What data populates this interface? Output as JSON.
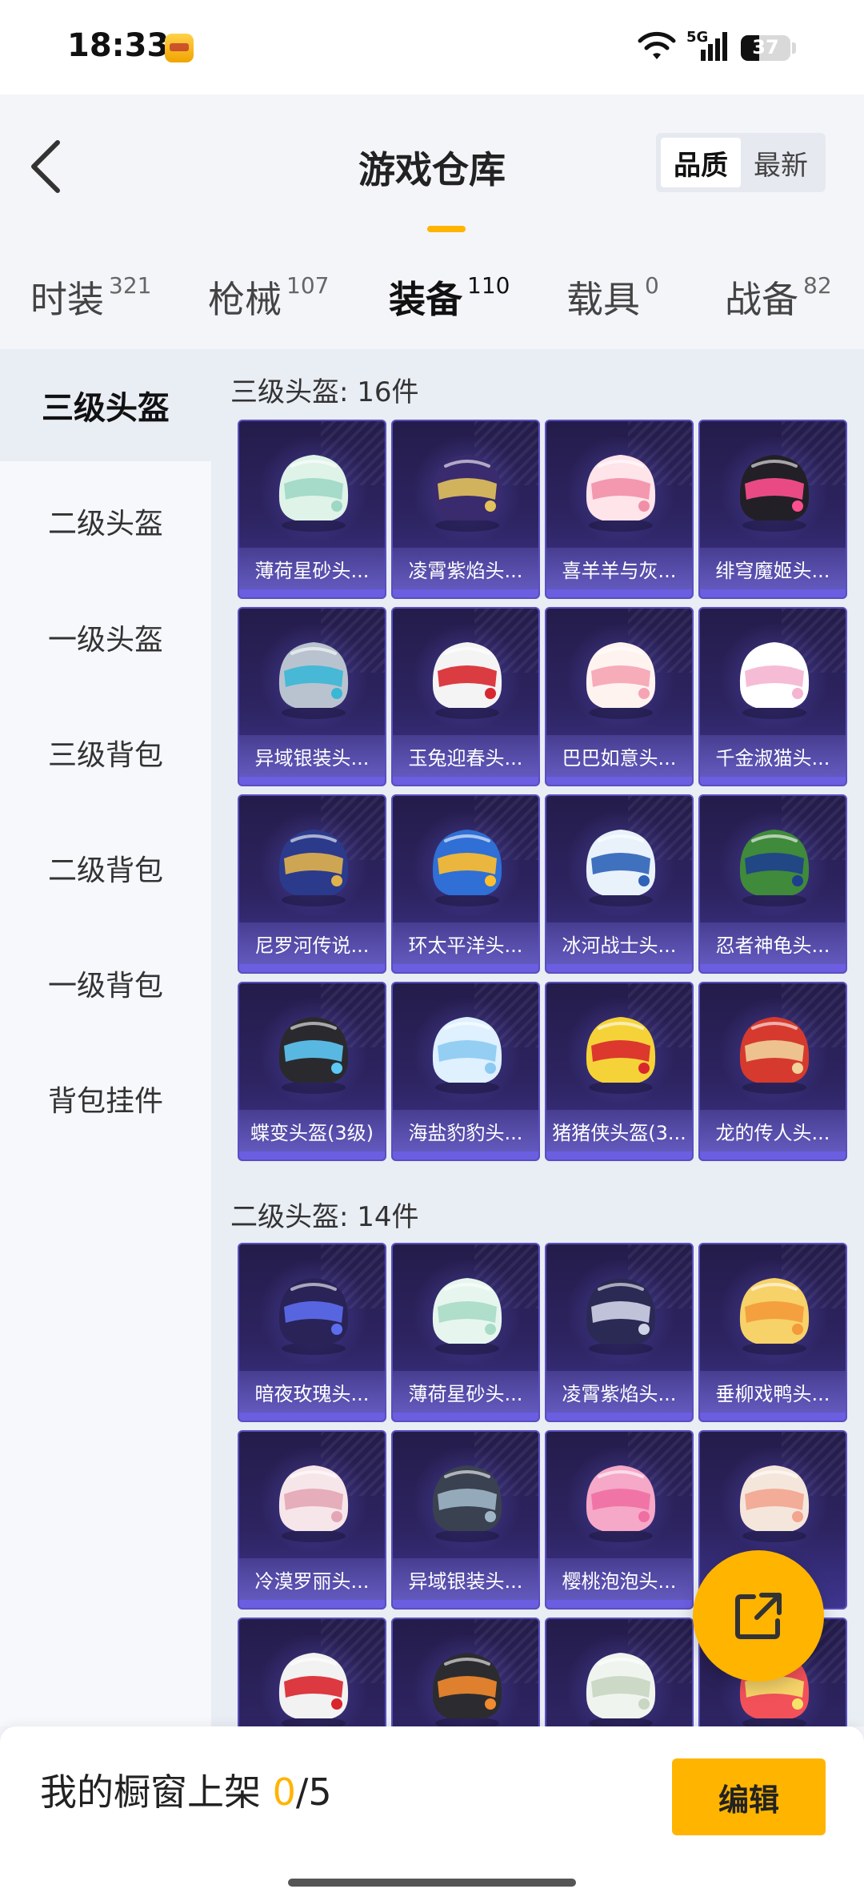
{
  "status": {
    "time": "18:33",
    "network": "5G",
    "battery": "37",
    "battery_level": 0.37
  },
  "header": {
    "title": "游戏仓库",
    "sort_options": [
      "品质",
      "最新"
    ],
    "tabs": [
      {
        "label": "时装",
        "count": "321"
      },
      {
        "label": "枪械",
        "count": "107"
      },
      {
        "label": "装备",
        "count": "110"
      },
      {
        "label": "载具",
        "count": "0"
      },
      {
        "label": "战备",
        "count": "82"
      }
    ]
  },
  "sidebar": {
    "items": [
      "三级头盔",
      "二级头盔",
      "一级头盔",
      "三级背包",
      "二级背包",
      "一级背包",
      "背包挂件"
    ]
  },
  "sections": [
    {
      "title": "三级头盔: 16件",
      "items": [
        {
          "name": "薄荷星砂头...",
          "colors": [
            "#dff3e8",
            "#9ed8c4"
          ]
        },
        {
          "name": "凌霄紫焰头...",
          "colors": [
            "#3a2b6e",
            "#e2c25b"
          ]
        },
        {
          "name": "喜羊羊与灰...",
          "colors": [
            "#ffe4ea",
            "#f28fa8"
          ]
        },
        {
          "name": "绯穹魔姬头...",
          "colors": [
            "#222026",
            "#ff4f8e"
          ]
        },
        {
          "name": "异域银装头...",
          "colors": [
            "#b9c3cf",
            "#3bb7d6"
          ]
        },
        {
          "name": "玉兔迎春头...",
          "colors": [
            "#f4f4f4",
            "#d8282f"
          ]
        },
        {
          "name": "巴巴如意头...",
          "colors": [
            "#fff3f0",
            "#f6a4b4"
          ]
        },
        {
          "name": "千金淑猫头...",
          "colors": [
            "#ffffff",
            "#f5b5d2"
          ]
        },
        {
          "name": "尼罗河传说...",
          "colors": [
            "#2c3a8c",
            "#e0b24c"
          ]
        },
        {
          "name": "环太平洋头...",
          "colors": [
            "#2f6fd6",
            "#ffbe2e"
          ]
        },
        {
          "name": "冰河战士头...",
          "colors": [
            "#e9f2fa",
            "#2e63b8"
          ]
        },
        {
          "name": "忍者神龟头...",
          "colors": [
            "#3f8a3b",
            "#1e3f8e"
          ]
        },
        {
          "name": "蝶变头盔(3级)",
          "colors": [
            "#2a2a2e",
            "#5ec8f5"
          ]
        },
        {
          "name": "海盐豹豹头...",
          "colors": [
            "#dff0ff",
            "#8ccaf2"
          ]
        },
        {
          "name": "猪猪侠头盔(3...",
          "colors": [
            "#f5d338",
            "#d9272e"
          ]
        },
        {
          "name": "龙的传人头...",
          "colors": [
            "#d63a2e",
            "#f0d29a"
          ]
        }
      ]
    },
    {
      "title": "二级头盔: 14件",
      "items": [
        {
          "name": "暗夜玫瑰头...",
          "colors": [
            "#2a2358",
            "#5c6ef0"
          ]
        },
        {
          "name": "薄荷星砂头...",
          "colors": [
            "#e6f6ee",
            "#a9dcc7"
          ]
        },
        {
          "name": "凌霄紫焰头...",
          "colors": [
            "#2b2a55",
            "#cfd3e8"
          ]
        },
        {
          "name": "垂柳戏鸭头...",
          "colors": [
            "#f7d268",
            "#f39a3a"
          ]
        },
        {
          "name": "冷漠罗丽头...",
          "colors": [
            "#f6e6ea",
            "#e4a6b6"
          ]
        },
        {
          "name": "异域银装头...",
          "colors": [
            "#3a4150",
            "#9fb6c6"
          ]
        },
        {
          "name": "樱桃泡泡头...",
          "colors": [
            "#f6a8c8",
            "#ef6fa2"
          ]
        },
        {
          "name": "",
          "colors": [
            "#f5e6dc",
            "#f3a58f"
          ]
        },
        {
          "name": "",
          "colors": [
            "#f2f2f2",
            "#d9252c"
          ]
        },
        {
          "name": "",
          "colors": [
            "#2c2c30",
            "#f28a2e"
          ]
        },
        {
          "name": "",
          "colors": [
            "#f0f4ee",
            "#c9d6c2"
          ]
        },
        {
          "name": "",
          "colors": [
            "#f3515a",
            "#f7e26a"
          ]
        }
      ]
    }
  ],
  "bottom": {
    "shelf_label": "我的橱窗上架 ",
    "shelf_current": "0",
    "shelf_total": "/5",
    "edit_label": "编辑"
  }
}
